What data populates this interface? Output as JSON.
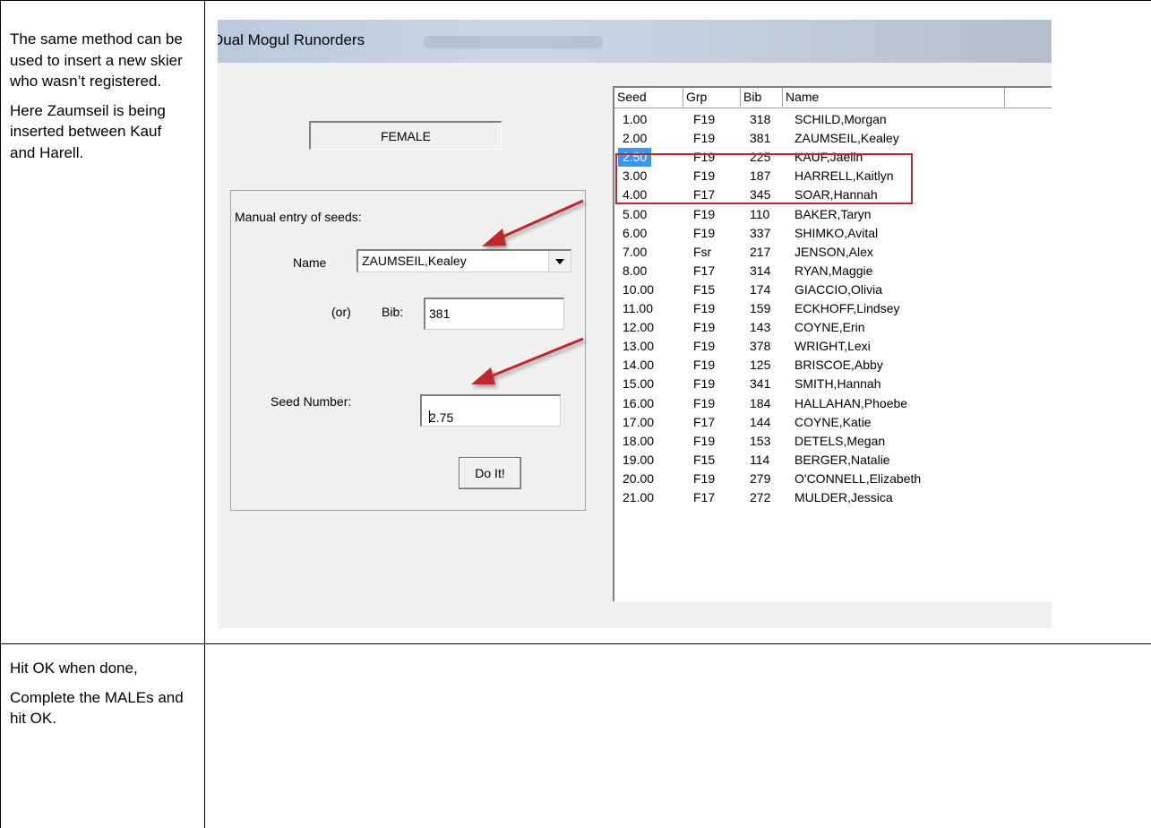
{
  "doc": {
    "row1_left": [
      "The same method can be used to insert a new skier who wasn’t registered.",
      "Here Zaumseil is being inserted between Kauf and Harell."
    ],
    "row2_left": [
      "Hit OK when done,",
      "Complete the MALEs and hit OK."
    ]
  },
  "window": {
    "title": "Dual Mogul Runorders",
    "gender": "FEMALE",
    "group_label": "Manual entry of seeds:",
    "name_label": "Name",
    "name_value": "ZAUMSEIL,Kealey",
    "or_label": "(or)",
    "bib_label": "Bib:",
    "bib_value": "381",
    "seed_label": "Seed Number:",
    "seed_value": "2.75",
    "doit_label": "Do It!"
  },
  "list": {
    "headers": [
      "Seed",
      "Grp",
      "Bib",
      "Name"
    ],
    "rows": [
      {
        "seed": "1.00",
        "grp": "F19",
        "bib": "318",
        "name": "SCHILD,Morgan"
      },
      {
        "seed": "2.00",
        "grp": "F19",
        "bib": "381",
        "name": "ZAUMSEIL,Kealey"
      },
      {
        "seed": "2.50",
        "grp": "F19",
        "bib": "225",
        "name": "KAUF,Jaelin"
      },
      {
        "seed": "3.00",
        "grp": "F19",
        "bib": "187",
        "name": "HARRELL,Kaitlyn"
      },
      {
        "seed": "4.00",
        "grp": "F17",
        "bib": "345",
        "name": "SOAR,Hannah"
      },
      {
        "seed": "5.00",
        "grp": "F19",
        "bib": "110",
        "name": "BAKER,Taryn"
      },
      {
        "seed": "6.00",
        "grp": "F19",
        "bib": "337",
        "name": "SHIMKO,Avital"
      },
      {
        "seed": "7.00",
        "grp": "Fsr",
        "bib": "217",
        "name": "JENSON,Alex"
      },
      {
        "seed": "8.00",
        "grp": "F17",
        "bib": "314",
        "name": "RYAN,Maggie"
      },
      {
        "seed": "10.00",
        "grp": "F15",
        "bib": "174",
        "name": "GIACCIO,Olivia"
      },
      {
        "seed": "11.00",
        "grp": "F19",
        "bib": "159",
        "name": "ECKHOFF,Lindsey"
      },
      {
        "seed": "12.00",
        "grp": "F19",
        "bib": "143",
        "name": "COYNE,Erin"
      },
      {
        "seed": "13.00",
        "grp": "F19",
        "bib": "378",
        "name": "WRIGHT,Lexi"
      },
      {
        "seed": "14.00",
        "grp": "F19",
        "bib": "125",
        "name": "BRISCOE,Abby"
      },
      {
        "seed": "15.00",
        "grp": "F19",
        "bib": "341",
        "name": "SMITH,Hannah"
      },
      {
        "seed": "16.00",
        "grp": "F19",
        "bib": "184",
        "name": "HALLAHAN,Phoebe"
      },
      {
        "seed": "17.00",
        "grp": "F17",
        "bib": "144",
        "name": "COYNE,Katie"
      },
      {
        "seed": "18.00",
        "grp": "F19",
        "bib": "153",
        "name": "DETELS,Megan"
      },
      {
        "seed": "19.00",
        "grp": "F15",
        "bib": "114",
        "name": "BERGER,Natalie"
      },
      {
        "seed": "20.00",
        "grp": "F19",
        "bib": "279",
        "name": "O'CONNELL,Elizabeth"
      },
      {
        "seed": "21.00",
        "grp": "F17",
        "bib": "272",
        "name": "MULDER,Jessica"
      }
    ],
    "selected_index": 2
  },
  "colors": {
    "highlight": "#c0262c",
    "selection": "#3399ff",
    "arrow": "#c0262c"
  }
}
